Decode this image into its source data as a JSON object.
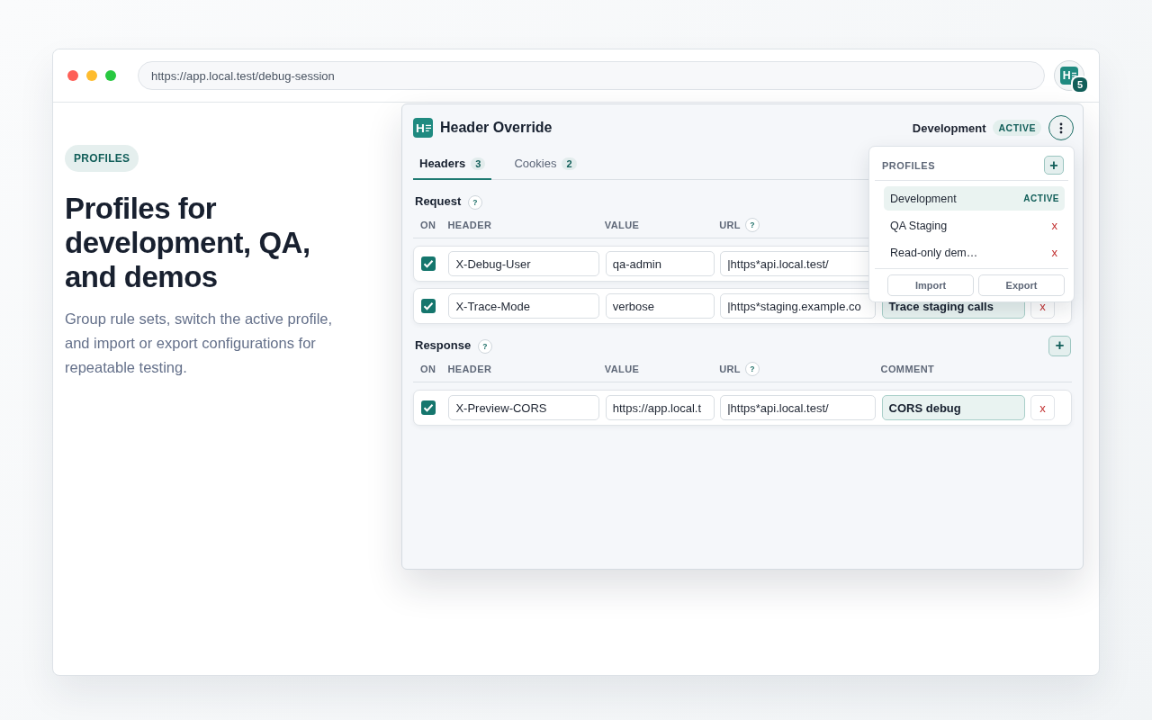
{
  "browser": {
    "address": "https://app.local.test/debug-session",
    "extension_logo": "H",
    "extension_badge": "5"
  },
  "hero": {
    "tag": "PROFILES",
    "title": "Profiles for development, QA, and demos",
    "description": "Group rule sets, switch the active profile, and import or export configurations for repeatable testing."
  },
  "popup": {
    "logo": "H",
    "title": "Header Override",
    "profile": "Development",
    "profile_status": "ACTIVE",
    "tabs": [
      {
        "label": "Headers",
        "count": "3",
        "selected": true
      },
      {
        "label": "Cookies",
        "count": "2",
        "selected": false
      }
    ],
    "sections": [
      {
        "title": "Request",
        "help": "?",
        "columns": [
          {
            "label": "ON"
          },
          {
            "label": "HEADER"
          },
          {
            "label": "VALUE"
          },
          {
            "label": "URL",
            "help": "?"
          }
        ],
        "rows": [
          {
            "enabled": true,
            "header": "X-Debug-User",
            "value": "qa-admin",
            "url": "|https*api.local.test/"
          },
          {
            "enabled": true,
            "header": "X-Trace-Mode",
            "value": "verbose",
            "url": "|https*staging.example.co",
            "comment": "Trace staging calls",
            "delete": "x"
          }
        ]
      },
      {
        "title": "Response",
        "help": "?",
        "add": "+",
        "columns": [
          {
            "label": "ON"
          },
          {
            "label": "HEADER"
          },
          {
            "label": "VALUE"
          },
          {
            "label": "URL",
            "help": "?"
          },
          {
            "label": "COMMENT"
          }
        ],
        "rows": [
          {
            "enabled": true,
            "header": "X-Preview-CORS",
            "value": "https://app.local.t",
            "url": "|https*api.local.test/",
            "comment": "CORS debug",
            "delete": "x"
          }
        ]
      }
    ],
    "menu": {
      "title": "PROFILES",
      "add": "+",
      "profiles": [
        {
          "name": "Development",
          "selected": true,
          "status": "ACTIVE"
        },
        {
          "name": "QA Staging",
          "selected": false,
          "delete": "x"
        },
        {
          "name": "Read-only dem…",
          "selected": false,
          "delete": "x"
        }
      ],
      "buttons": [
        "Import",
        "Export"
      ]
    }
  }
}
